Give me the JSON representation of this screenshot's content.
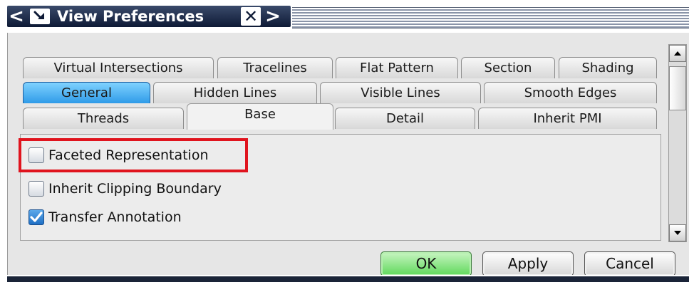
{
  "window": {
    "title": "View Preferences",
    "nav_prev_glyph": "<",
    "nav_next_glyph": ">",
    "close_glyph": "✕"
  },
  "tabs": {
    "row1": [
      "Virtual Intersections",
      "Tracelines",
      "Flat Pattern",
      "Section",
      "Shading"
    ],
    "row2": [
      "General",
      "Hidden Lines",
      "Visible Lines",
      "Smooth Edges"
    ],
    "row3": [
      "Threads",
      "Base",
      "Detail",
      "Inherit PMI"
    ],
    "active": "Base",
    "highlighted": "General"
  },
  "options": [
    {
      "label": "Faceted Representation",
      "checked": false
    },
    {
      "label": "Inherit Clipping Boundary",
      "checked": false
    },
    {
      "label": "Transfer Annotation",
      "checked": true
    }
  ],
  "buttons": {
    "ok": "OK",
    "apply": "Apply",
    "cancel": "Cancel"
  },
  "colors": {
    "highlight_box": "#e0141e",
    "general_tab": "#2f9be8",
    "ok_button": "#5ed85a",
    "titlebar": "#0e1a36"
  },
  "icons": {
    "pin": "pin-icon",
    "close": "close-icon",
    "scroll_up": "arrow-up-icon",
    "scroll_down": "arrow-down-icon",
    "check": "checkmark-icon"
  }
}
